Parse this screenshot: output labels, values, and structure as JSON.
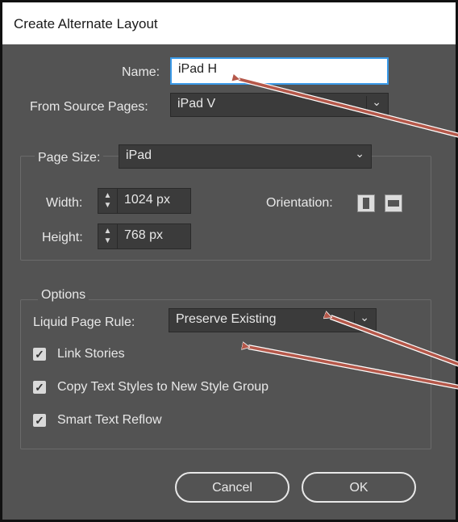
{
  "dialog": {
    "title": "Create Alternate Layout"
  },
  "name": {
    "label": "Name:",
    "value": "iPad H"
  },
  "source_pages": {
    "label": "From Source Pages:",
    "value": "iPad V"
  },
  "page_size": {
    "label": "Page Size:",
    "value": "iPad",
    "width_label": "Width:",
    "width_value": "1024 px",
    "height_label": "Height:",
    "height_value": "768 px",
    "orientation_label": "Orientation:"
  },
  "options": {
    "group_label": "Options",
    "liquid_rule_label": "Liquid Page Rule:",
    "liquid_rule_value": "Preserve Existing",
    "checkboxes": [
      {
        "label": "Link Stories",
        "checked": true
      },
      {
        "label": "Copy Text Styles to New Style Group",
        "checked": true
      },
      {
        "label": "Smart Text Reflow",
        "checked": true
      }
    ]
  },
  "buttons": {
    "cancel": "Cancel",
    "ok": "OK"
  },
  "colors": {
    "panel": "#535353",
    "annotation_arrow": "#b5584a",
    "focus_ring": "#3b9ae8"
  },
  "icons": {
    "dropdown": "chevron-down-icon",
    "spinner": "spinner-arrows-icon",
    "portrait": "portrait-icon",
    "landscape": "landscape-icon"
  }
}
